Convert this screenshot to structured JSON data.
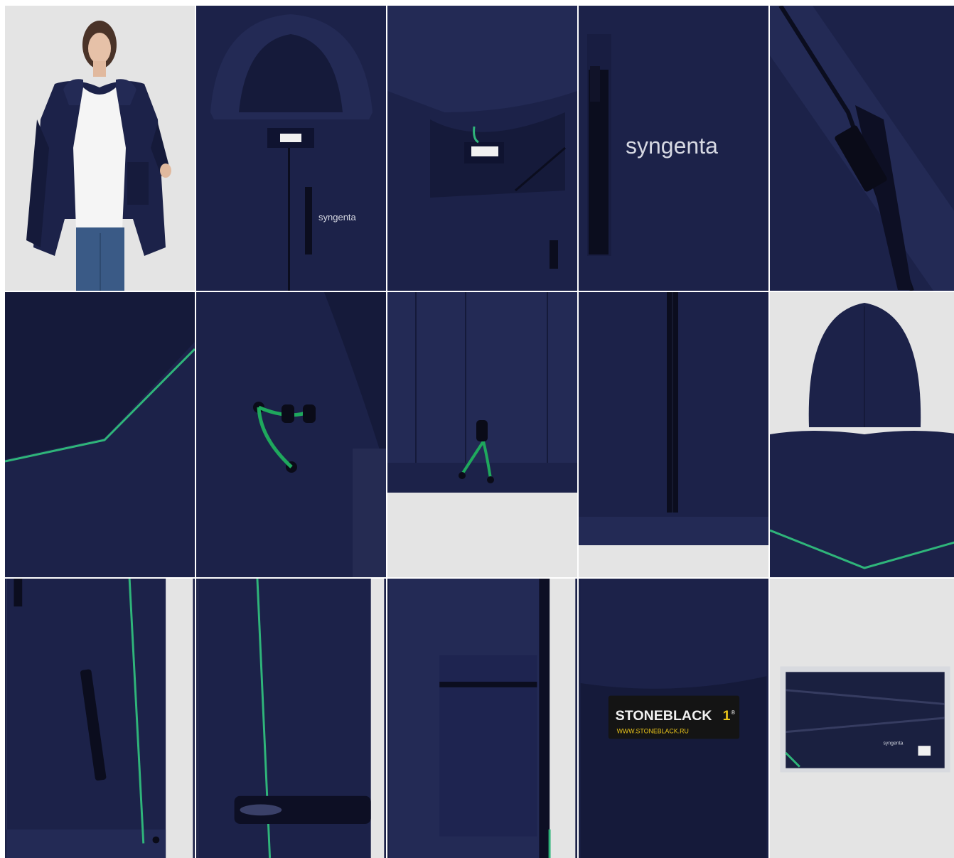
{
  "brand": {
    "logo_text": "syngenta",
    "label_brand": "STONEBLACK",
    "label_mark": "1",
    "label_registered": "®",
    "label_url": "WWW.STONEBLACK.RU",
    "sleeve_tag": "STONEBLACK"
  },
  "colors": {
    "navy": "#1c2249",
    "piping_green": "#2fb57a",
    "background_grey": "#e4e4e4"
  },
  "tiles": [
    {
      "id": "model-front"
    },
    {
      "id": "hood-front"
    },
    {
      "id": "collar-inside"
    },
    {
      "id": "chest-logo"
    },
    {
      "id": "zipper-pull"
    },
    {
      "id": "back-piping"
    },
    {
      "id": "hood-drawcord"
    },
    {
      "id": "hem-drawcord"
    },
    {
      "id": "front-zipper"
    },
    {
      "id": "hood-back"
    },
    {
      "id": "side-pocket"
    },
    {
      "id": "sleeve-cuff"
    },
    {
      "id": "inner-pocket"
    },
    {
      "id": "brand-label"
    },
    {
      "id": "packaging"
    }
  ]
}
